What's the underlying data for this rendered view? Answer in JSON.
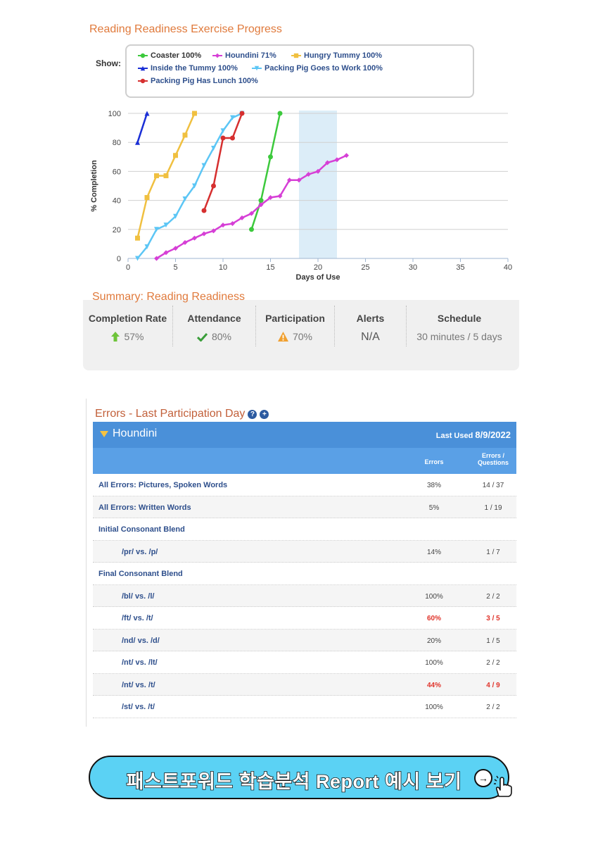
{
  "progress": {
    "title": "Reading Readiness Exercise Progress",
    "show_label": "Show:",
    "legend": [
      {
        "label": "Coaster 100%",
        "color": "#3cc93c",
        "marker": "circle",
        "active": true
      },
      {
        "label": "Houndini 71%",
        "color": "#d63fd6",
        "marker": "diamond",
        "active": false
      },
      {
        "label": "Hungry Tummy 100%",
        "color": "#f0c040",
        "marker": "square",
        "active": false
      },
      {
        "label": "Inside the Tummy 100%",
        "color": "#1a2fd6",
        "marker": "triangle",
        "active": false
      },
      {
        "label": "Packing Pig Goes to Work 100%",
        "color": "#5cc6f5",
        "marker": "triangle-down",
        "active": false
      },
      {
        "label": "Packing Pig Has Lunch 100%",
        "color": "#d62f2f",
        "marker": "circle",
        "active": false
      }
    ]
  },
  "chart_data": {
    "type": "line",
    "xlabel": "Days of Use",
    "ylabel": "% Completion",
    "xlim": [
      0,
      40
    ],
    "ylim": [
      0,
      100
    ],
    "x_ticks": [
      0,
      5,
      10,
      15,
      20,
      25,
      30,
      35,
      40
    ],
    "y_ticks": [
      0,
      20,
      40,
      60,
      80,
      100
    ],
    "grid": "horizontal",
    "shaded_x_range": [
      18,
      22
    ],
    "series": [
      {
        "name": "Coaster 100%",
        "color": "#3cc93c",
        "marker": "circle",
        "x": [
          13,
          14,
          15,
          16
        ],
        "y": [
          20,
          40,
          70,
          100
        ]
      },
      {
        "name": "Houndini 71%",
        "color": "#d63fd6",
        "marker": "diamond",
        "x": [
          3,
          4,
          5,
          6,
          7,
          8,
          9,
          10,
          11,
          12,
          13,
          14,
          15,
          16,
          17,
          18,
          19,
          20,
          21,
          22,
          23
        ],
        "y": [
          0,
          4,
          7,
          11,
          14,
          17,
          19,
          23,
          24,
          28,
          31,
          37,
          42,
          43,
          54,
          54,
          58,
          60,
          66,
          68,
          71
        ]
      },
      {
        "name": "Hungry Tummy 100%",
        "color": "#f0c040",
        "marker": "square",
        "x": [
          1,
          2,
          3,
          4,
          5,
          6,
          7
        ],
        "y": [
          14,
          42,
          57,
          57,
          71,
          85,
          100
        ]
      },
      {
        "name": "Inside the Tummy 100%",
        "color": "#1a2fd6",
        "marker": "triangle",
        "x": [
          1,
          2
        ],
        "y": [
          80,
          100
        ]
      },
      {
        "name": "Packing Pig Goes to Work 100%",
        "color": "#5cc6f5",
        "marker": "triangle-down",
        "x": [
          1,
          2,
          3,
          4,
          5,
          6,
          7,
          8,
          9,
          10,
          11,
          12
        ],
        "y": [
          0,
          8,
          20,
          23,
          29,
          41,
          50,
          64,
          76,
          88,
          97,
          100
        ]
      },
      {
        "name": "Packing Pig Has Lunch 100%",
        "color": "#d62f2f",
        "marker": "circle",
        "x": [
          8,
          9,
          10,
          11,
          12
        ],
        "y": [
          33,
          50,
          83,
          83,
          100
        ]
      }
    ]
  },
  "summary": {
    "title": "Summary: Reading Readiness",
    "columns": [
      {
        "heading": "Completion Rate",
        "value": "57%",
        "icon": "up-arrow-icon",
        "icon_color": "#6ec43a"
      },
      {
        "heading": "Attendance",
        "value": "80%",
        "icon": "check-icon",
        "icon_color": "#3a9e3a"
      },
      {
        "heading": "Participation",
        "value": "70%",
        "icon": "warning-icon",
        "icon_color": "#f0a030"
      },
      {
        "heading": "Alerts",
        "value": "N/A",
        "icon": "",
        "icon_color": ""
      },
      {
        "heading": "Schedule",
        "value": "30 minutes / 5 days",
        "icon": "",
        "icon_color": ""
      }
    ]
  },
  "errors": {
    "title": "Errors - Last Participation Day",
    "help_icon": "?",
    "add_icon": "+",
    "exercise": "Houndini",
    "last_used_label": "Last Used",
    "last_used_date": "8/9/2022",
    "col_errors": "Errors",
    "col_ratio": "Errors / Questions",
    "rows": [
      {
        "label": "All Errors: Pictures, Spoken Words",
        "pct": "38%",
        "ratio": "14 / 37",
        "indent": false,
        "alert": false
      },
      {
        "label": "All Errors: Written Words",
        "pct": "5%",
        "ratio": "1 / 19",
        "indent": false,
        "alert": false
      },
      {
        "label": "Initial Consonant Blend",
        "pct": "",
        "ratio": "",
        "indent": false,
        "alert": false
      },
      {
        "label": "/pr/ vs. /p/",
        "pct": "14%",
        "ratio": "1 / 7",
        "indent": true,
        "alert": false
      },
      {
        "label": "Final Consonant Blend",
        "pct": "",
        "ratio": "",
        "indent": false,
        "alert": false
      },
      {
        "label": "/bl/ vs. /l/",
        "pct": "100%",
        "ratio": "2 / 2",
        "indent": true,
        "alert": false
      },
      {
        "label": "/ft/ vs. /t/",
        "pct": "60%",
        "ratio": "3 / 5",
        "indent": true,
        "alert": true
      },
      {
        "label": "/nd/ vs. /d/",
        "pct": "20%",
        "ratio": "1 / 5",
        "indent": true,
        "alert": false
      },
      {
        "label": "/nt/ vs. /lt/",
        "pct": "100%",
        "ratio": "2 / 2",
        "indent": true,
        "alert": false
      },
      {
        "label": "/nt/ vs. /t/",
        "pct": "44%",
        "ratio": "4 / 9",
        "indent": true,
        "alert": true
      },
      {
        "label": "/st/ vs. /t/",
        "pct": "100%",
        "ratio": "2 / 2",
        "indent": true,
        "alert": false
      }
    ]
  },
  "cta": {
    "label": "패스트포워드 학습분석 Report 예시 보기",
    "arrow": "→"
  }
}
